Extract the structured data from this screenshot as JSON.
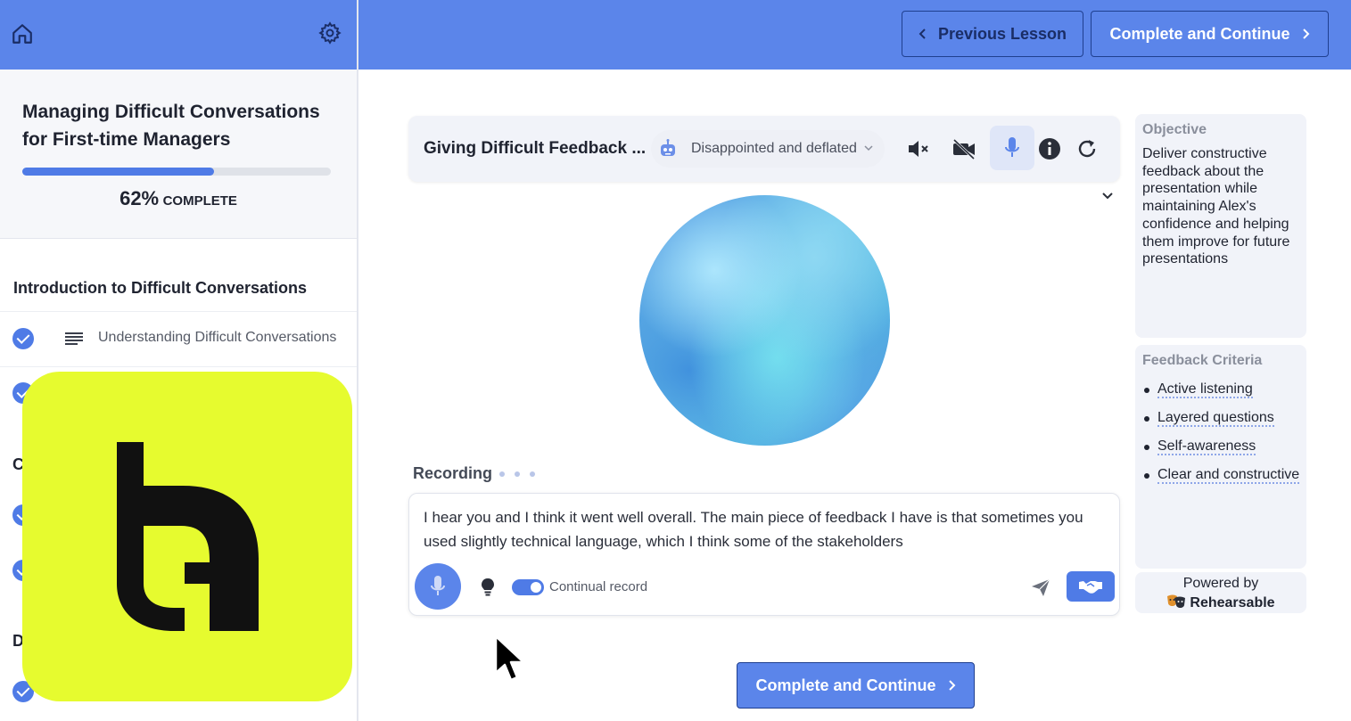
{
  "header": {
    "previous_label": "Previous Lesson",
    "complete_label": "Complete and Continue"
  },
  "sidebar": {
    "course_title": "Managing Difficult Conversations for First-time Managers",
    "progress": {
      "fraction": 0.62,
      "percent_text": "62%",
      "complete_word": "COMPLETE"
    },
    "section_title": "Introduction to Difficult Conversations",
    "lessons": [
      {
        "label": "Understanding Difficult Conversations",
        "completed": true,
        "icon": "text-lines-icon"
      }
    ],
    "partial_letters": [
      "C",
      "D"
    ]
  },
  "scenario": {
    "title": "Giving Difficult Feedback ...",
    "mood": "Disappointed and deflated",
    "recording_label": "Recording",
    "transcript": "I hear you and I think it went well overall. The main piece of feedback I have is that sometimes you used slightly technical language, which I think some of the stakeholders",
    "continual_record_label": "Continual record",
    "continual_record_on": true
  },
  "objective": {
    "heading": "Objective",
    "text": "Deliver constructive feedback about the presentation while maintaining Alex's confidence and helping them improve for future presentations"
  },
  "criteria": {
    "heading": "Feedback Criteria",
    "items": [
      "Active listening",
      "Layered questions",
      "Self-awareness",
      "Clear and constructive"
    ]
  },
  "powered": {
    "by_label": "Powered by",
    "brand": "Rehearsable"
  },
  "colors": {
    "header_blue": "#5b85ea",
    "accent_blue": "#4f7be6",
    "logo_yellow": "#e6fb2f"
  }
}
